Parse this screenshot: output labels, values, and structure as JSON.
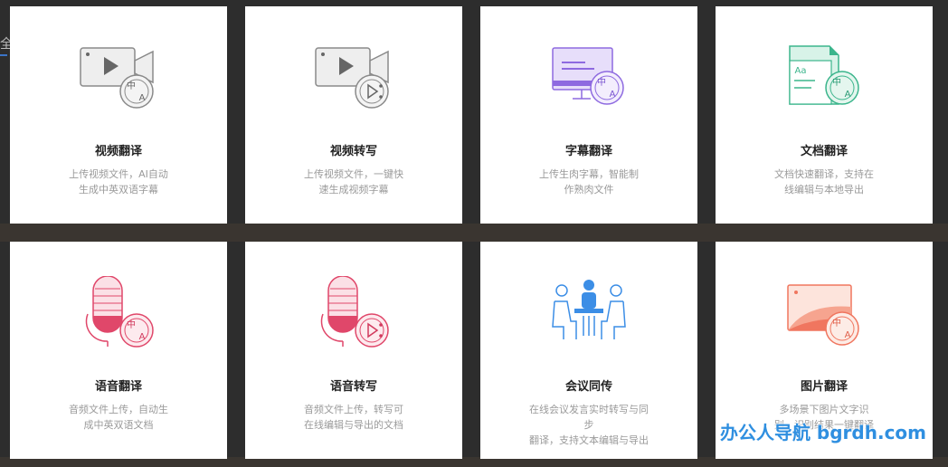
{
  "background": {
    "left_char": "全"
  },
  "cards": [
    {
      "title": "视频翻译",
      "desc_line1": "上传视频文件，AI自动",
      "desc_line2": "生成中英双语字幕",
      "icon": "video-translate-icon"
    },
    {
      "title": "视频转写",
      "desc_line1": "上传视频文件，一键快",
      "desc_line2": "速生成视频字幕",
      "icon": "video-transcribe-icon"
    },
    {
      "title": "字幕翻译",
      "desc_line1": "上传生肉字幕，智能制",
      "desc_line2": "作熟肉文件",
      "icon": "subtitle-translate-icon"
    },
    {
      "title": "文档翻译",
      "desc_line1": "文档快速翻译，支持在",
      "desc_line2": "线编辑与本地导出",
      "icon": "document-translate-icon"
    },
    {
      "title": "语音翻译",
      "desc_line1": "音频文件上传，自动生",
      "desc_line2": "成中英双语文档",
      "icon": "voice-translate-icon"
    },
    {
      "title": "语音转写",
      "desc_line1": "音频文件上传，转写可",
      "desc_line2": "在线编辑与导出的文档",
      "icon": "voice-transcribe-icon"
    },
    {
      "title": "会议同传",
      "desc_line1": "在线会议发言实时转写与同步",
      "desc_line2": "翻译，支持文本编辑与导出",
      "icon": "meeting-interpret-icon"
    },
    {
      "title": "图片翻译",
      "desc_line1": "多场景下图片文字识",
      "desc_line2": "别，识别结果一键翻译",
      "icon": "image-translate-icon"
    }
  ],
  "badge_glyphs": {
    "zh": "中",
    "en": "A"
  },
  "doc_glyph": "Aa",
  "watermark": "办公人导航 bgrdh.com",
  "colors": {
    "gray": "#8a8a8a",
    "purple": "#8e6ae0",
    "green": "#3bb58c",
    "red": "#e0476a",
    "blue": "#3c8ee6",
    "orange": "#f0765f"
  }
}
